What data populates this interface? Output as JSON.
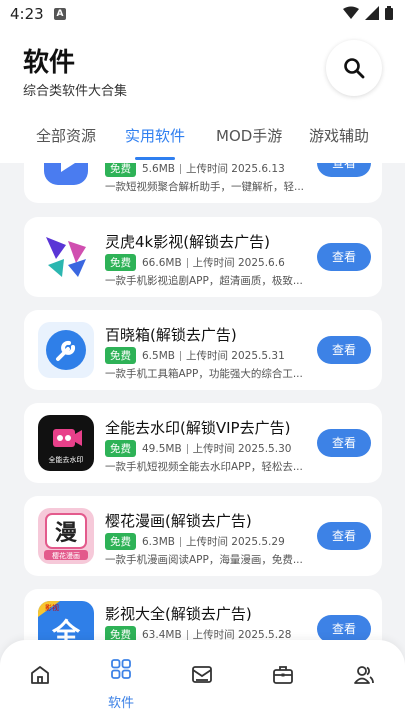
{
  "status_bar": {
    "time": "4:23",
    "notif_icon": "a-notification-icon"
  },
  "header": {
    "title": "软件",
    "subtitle": "综合类软件大合集",
    "search_icon": "search-icon"
  },
  "tabs": [
    {
      "label": "全部资源",
      "active": false
    },
    {
      "label": "实用软件",
      "active": true
    },
    {
      "label": "MOD手游",
      "active": false
    },
    {
      "label": "游戏辅助",
      "active": false
    }
  ],
  "apps": [
    {
      "name": "",
      "badge": "免费",
      "size": "5.6MB",
      "upload": "上传时间 2025.6.13",
      "desc": "一款短视频聚合解析助手，一键解析，轻...",
      "button": "查看",
      "icon": "play-icon",
      "icon_color": "#4a7cf0"
    },
    {
      "name": "灵虎4k影视(解锁去广告)",
      "badge": "免费",
      "size": "66.6MB",
      "upload": "上传时间 2025.6.6",
      "desc": "一款手机影视追剧APP，超清画质，极致...",
      "button": "查看",
      "icon": "linghu-logo-icon",
      "icon_color": "#3a3fd0"
    },
    {
      "name": "百晓箱(解锁去广告)",
      "badge": "免费",
      "size": "6.5MB",
      "upload": "上传时间 2025.5.31",
      "desc": "一款手机工具箱APP，功能强大的综合工...",
      "button": "查看",
      "icon": "wrench-icon",
      "icon_color": "#2f7fe8"
    },
    {
      "name": "全能去水印(解锁VIP去广告)",
      "badge": "免费",
      "size": "49.5MB",
      "upload": "上传时间 2025.5.30",
      "desc": "一款手机短视频全能去水印APP，轻松去...",
      "button": "查看",
      "icon": "video-camera-icon",
      "icon_color": "#111111"
    },
    {
      "name": "樱花漫画(解锁去广告)",
      "badge": "免费",
      "size": "6.3MB",
      "upload": "上传时间 2025.5.29",
      "desc": "一款手机漫画阅读APP，海量漫画，免费...",
      "button": "查看",
      "icon": "manga-logo-icon",
      "icon_color": "#e35a8c"
    },
    {
      "name": "影视大全(解锁去广告)",
      "badge": "免费",
      "size": "63.4MB",
      "upload": "上传时间 2025.5.28",
      "desc": "",
      "button": "查看",
      "icon": "quan-logo-icon",
      "icon_color": "#2f7fe8"
    }
  ],
  "icon_text": {
    "watermark": "全能去水印",
    "manga_big": "漫",
    "manga_small": "樱花漫画",
    "quan": "全",
    "quan_tag": "影视"
  },
  "bottom_nav": [
    {
      "label": "",
      "icon": "home-icon"
    },
    {
      "label": "软件",
      "icon": "grid-icon",
      "active": true
    },
    {
      "label": "",
      "icon": "message-icon"
    },
    {
      "label": "",
      "icon": "toolbox-icon"
    },
    {
      "label": "",
      "icon": "users-icon"
    }
  ],
  "colors": {
    "accent": "#2f7ff0",
    "badge_green": "#2eb257",
    "button_blue": "#3d82e6"
  }
}
